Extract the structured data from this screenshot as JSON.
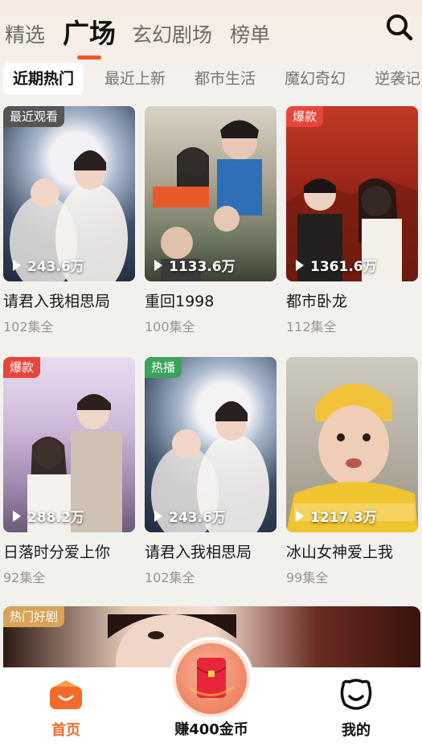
{
  "header": {
    "tabs": [
      {
        "label": "精选"
      },
      {
        "label": "广场"
      },
      {
        "label": "玄幻剧场"
      },
      {
        "label": "榜单"
      }
    ],
    "active_tab": "广场",
    "search_icon": "search-icon"
  },
  "categories": [
    "近期热门",
    "最近上新",
    "都市生活",
    "魔幻奇幻",
    "逆袭记"
  ],
  "shows": [
    {
      "title": "请君入我相思局",
      "episodes": "102集全",
      "plays": "243.6万",
      "badge": "最近观看",
      "badge_color": "#555555"
    },
    {
      "title": "重回1998",
      "episodes": "100集全",
      "plays": "1133.6万",
      "badge": "",
      "badge_color": ""
    },
    {
      "title": "都市卧龙",
      "episodes": "112集全",
      "plays": "1361.6万",
      "badge": "爆款",
      "badge_color": "#e8453c"
    },
    {
      "title": "日落时分爱上你",
      "episodes": "92集全",
      "plays": "288.2万",
      "badge": "爆款",
      "badge_color": "#e8453c"
    },
    {
      "title": "请君入我相思局",
      "episodes": "102集全",
      "plays": "243.6万",
      "badge": "热播",
      "badge_color": "#3aa35a"
    },
    {
      "title": "冰山女神爱上我",
      "episodes": "99集全",
      "plays": "1217.3万",
      "badge": "",
      "badge_color": ""
    }
  ],
  "feature": {
    "badge": "热门好剧"
  },
  "bottom_nav": {
    "home_label": "首页",
    "reward_label": "赚400金币",
    "me_label": "我的"
  },
  "colors": {
    "accent": "#f0562a",
    "home_icon": "#f46a2a"
  }
}
